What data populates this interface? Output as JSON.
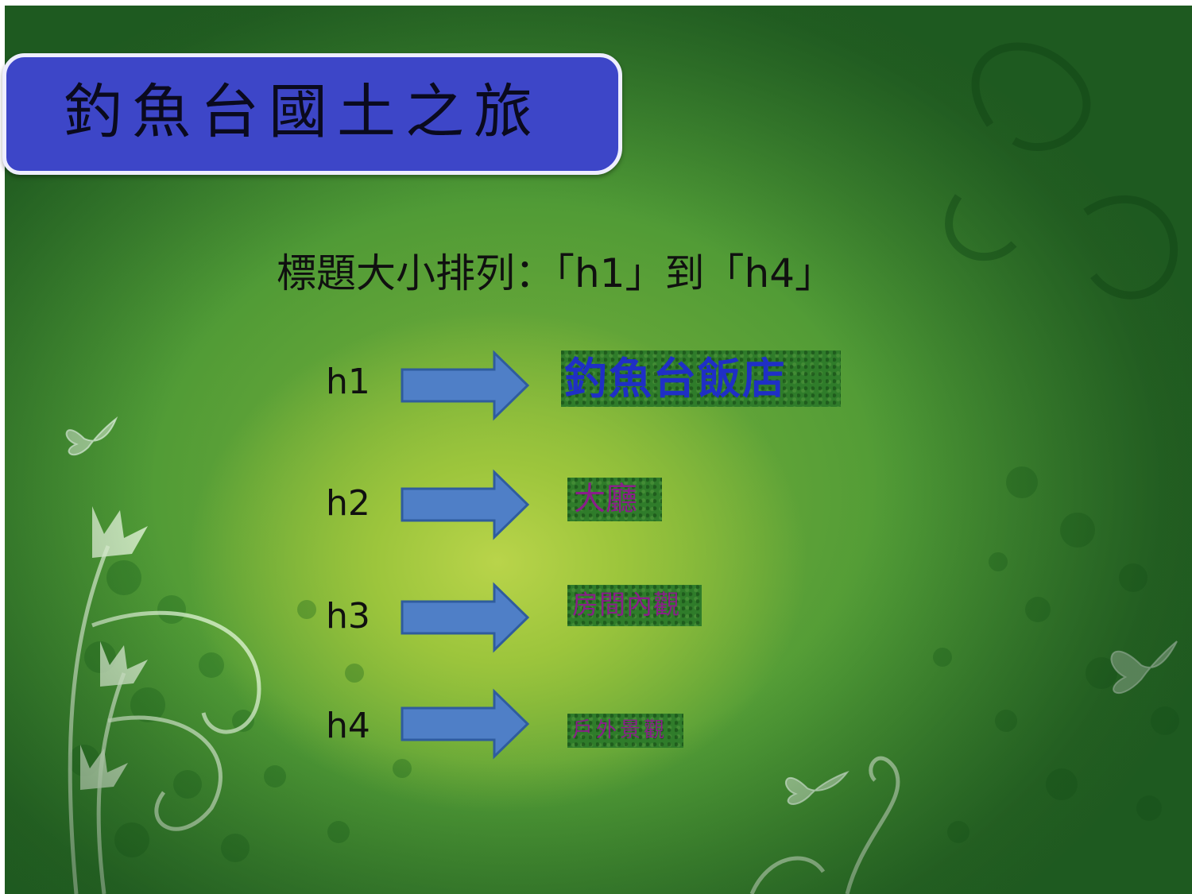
{
  "slide": {
    "title": "釣魚台國土之旅",
    "subtitle": "標題大小排列：「h1」到「h4」"
  },
  "rows": [
    {
      "label": "h1",
      "text": "釣魚台飯店",
      "text_color": "#1f2fc6"
    },
    {
      "label": "h2",
      "text": "大廳",
      "text_color": "#8a1e8a"
    },
    {
      "label": "h3",
      "text": "房間內觀",
      "text_color": "#8a1e8a"
    },
    {
      "label": "h4",
      "text": "戶外景觀",
      "text_color": "#8a1e8a"
    }
  ],
  "colors": {
    "title_box": "#3d46c8",
    "arrow_fill": "#4f7fc7",
    "arrow_stroke": "#2f5c9e",
    "background": "#4f9a36"
  }
}
